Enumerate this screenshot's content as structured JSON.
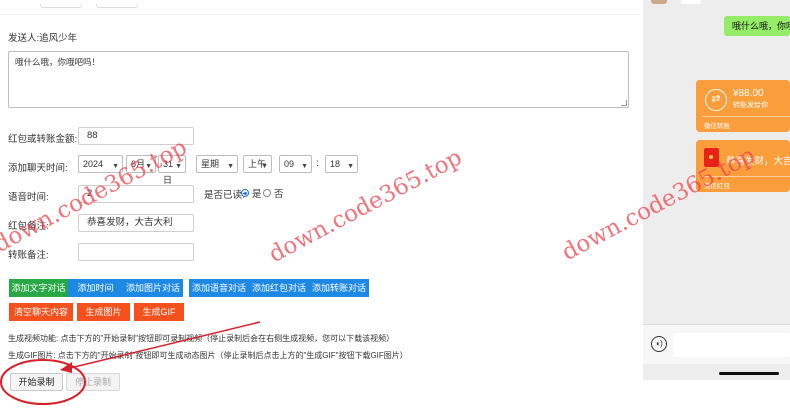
{
  "sender": {
    "label": "发送人:",
    "value": "追风少年"
  },
  "message": {
    "value": "哦什么哦，你哦吧吗！"
  },
  "amount": {
    "label": "红包或转账金额:",
    "value": "88"
  },
  "chat_time": {
    "label": "添加聊天时间:",
    "year": "2024",
    "month": "6月",
    "day": "31日",
    "weekday": "星期",
    "ampm": "上午",
    "hour": "09",
    "colon": ":",
    "minute": "18"
  },
  "voice_time": {
    "label": "语音时间:",
    "value": "2"
  },
  "read_status": {
    "label": "是否已读:",
    "yes": "是",
    "no": "否",
    "selected": "是"
  },
  "red_packet_note": {
    "label": "红包备注:",
    "value": "恭喜发财，大吉大利"
  },
  "transfer_note": {
    "label": "转账备注:",
    "value": ""
  },
  "buttons": {
    "add_text": "添加文字对话",
    "add_time": "添加时间",
    "add_image": "添加图片对话",
    "add_voice": "添加语音对话",
    "add_red_packet": "添加红包对话",
    "add_transfer": "添加转账对话",
    "clear_chat": "清空聊天内容",
    "gen_image": "生成图片",
    "gen_gif": "生成GIF",
    "start_record": "开始录制",
    "stop_record": "停止录制"
  },
  "notes": {
    "video": "生成视频功能: 点击下方的\"开始录制\"按钮即可录制视频（停止录制后会在右侧生成视频，您可以下载该视频）",
    "gif": "生成GIF图片: 点击下方的\"开始录制\"按钮即可生成动态图片（停止录制后点击上方的\"生成GIF\"按钮下载GIF图片）"
  },
  "phone": {
    "bubble_text": "哦什么哦，你哦",
    "transfer_amount": "¥88.00",
    "transfer_sub": "转账发给你",
    "transfer_footer": "微信转账",
    "red_packet_text": "恭喜发财，大吉",
    "red_packet_footer": "微信红包"
  },
  "watermark": "down.code365.top",
  "colors": {
    "green": "#28a745",
    "blue": "#1e88e5",
    "orange": "#f4511e",
    "bubble": "#95ec69",
    "card": "#fa9d3b",
    "annotation": "#d8202a"
  }
}
